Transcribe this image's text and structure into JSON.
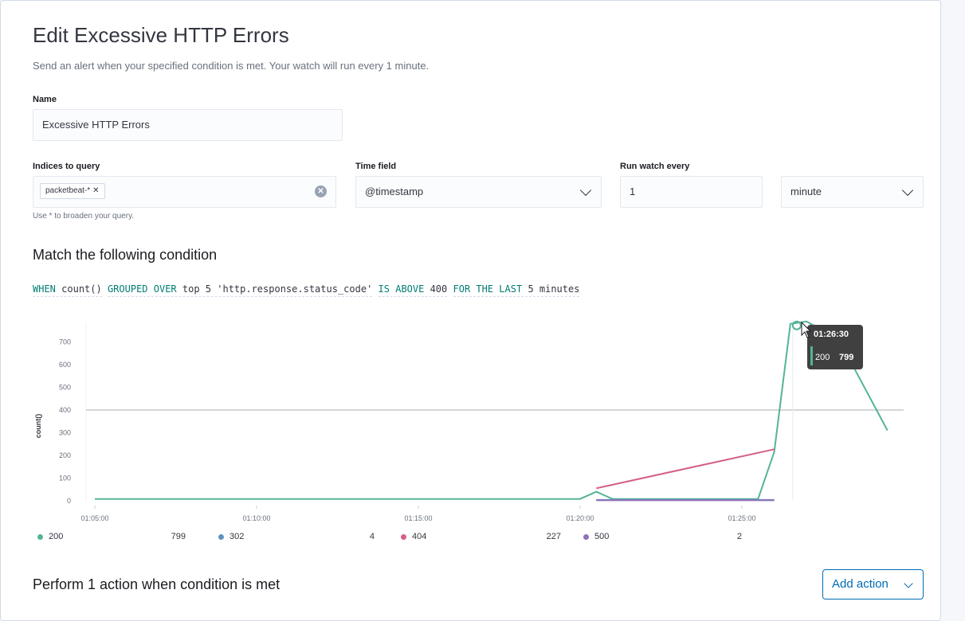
{
  "header": {
    "title": "Edit Excessive HTTP Errors",
    "subtitle": "Send an alert when your specified condition is met. Your watch will run every 1 minute."
  },
  "form": {
    "name_label": "Name",
    "name_value": "Excessive HTTP Errors",
    "indices_label": "Indices to query",
    "indices_chip": "packetbeat-*",
    "indices_help": "Use * to broaden your query.",
    "time_field_label": "Time field",
    "time_field_value": "@timestamp",
    "run_every_label": "Run watch every",
    "run_every_value": "1",
    "run_every_unit": "minute"
  },
  "condition": {
    "section_title": "Match the following condition",
    "when": "WHEN",
    "agg": "count()",
    "grouped_over": "GROUPED OVER",
    "group": "top 5 'http.response.status_code'",
    "is_above": "IS ABOVE",
    "threshold": "400",
    "for_the_last": "FOR THE LAST",
    "window": "5 minutes"
  },
  "chart_data": {
    "type": "line",
    "ylabel": "count()",
    "xlabel": "",
    "x_ticks": [
      "01:05:00",
      "01:10:00",
      "01:15:00",
      "01:20:00",
      "01:25:00"
    ],
    "y_ticks": [
      0,
      100,
      200,
      300,
      400,
      500,
      600,
      700
    ],
    "ylim": [
      0,
      800
    ],
    "xlim_minutes": [
      65,
      90
    ],
    "threshold": 400,
    "series": [
      {
        "name": "200",
        "color": "#54b399",
        "x": [
          65,
          80,
          80.5,
          81,
          85,
          85.5,
          86,
          86.5,
          87,
          88,
          89.5
        ],
        "y": [
          8,
          8,
          40,
          8,
          8,
          8,
          215,
          780,
          790,
          710,
          310
        ]
      },
      {
        "name": "302",
        "color": "#6092c0",
        "x": [
          80.5,
          86
        ],
        "y": [
          4,
          4
        ]
      },
      {
        "name": "404",
        "color": "#d36086",
        "x": [
          80.5,
          86
        ],
        "y": [
          55,
          227
        ]
      },
      {
        "name": "500",
        "color": "#9170b8",
        "x": [
          80.5,
          86
        ],
        "y": [
          2,
          2
        ]
      }
    ],
    "legend": [
      {
        "name": "200",
        "value": "799",
        "color": "#54b399"
      },
      {
        "name": "302",
        "value": "4",
        "color": "#6092c0"
      },
      {
        "name": "404",
        "value": "227",
        "color": "#d36086"
      },
      {
        "name": "500",
        "value": "2",
        "color": "#9170b8"
      }
    ],
    "tooltip": {
      "time": "01:26:30",
      "series": "200",
      "value": "799"
    }
  },
  "footer": {
    "actions_title": "Perform 1 action when condition is met",
    "add_action_label": "Add action"
  }
}
